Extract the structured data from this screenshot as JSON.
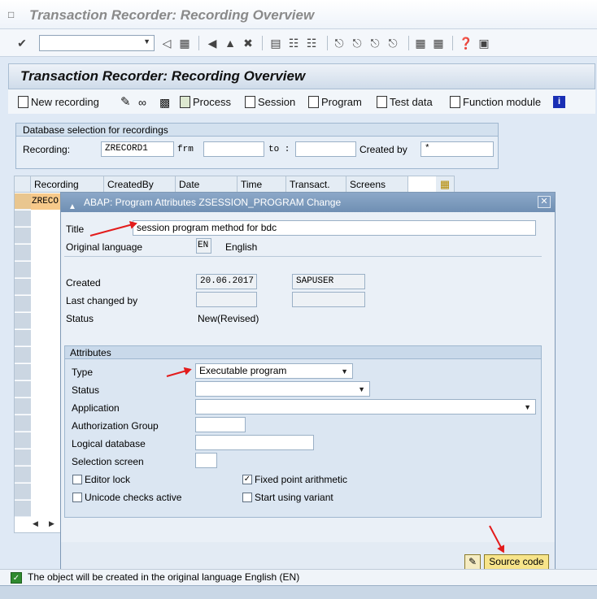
{
  "window": {
    "title": "Transaction Recorder: Recording Overview"
  },
  "toolbar": {
    "command_field": "",
    "icons": [
      "enter-icon",
      "back-icon",
      "save-icon",
      "back-nav-icon",
      "exit-icon",
      "cancel-icon",
      "print-icon",
      "find-icon",
      "find-next-icon",
      "first-page-icon",
      "prev-page-icon",
      "next-page-icon",
      "last-page-icon",
      "new-session-icon",
      "shortcut-icon",
      "help-icon",
      "customize-icon"
    ]
  },
  "screen": {
    "title": "Transaction Recorder: Recording Overview"
  },
  "app_toolbar": {
    "new_recording": "New recording",
    "process": "Process",
    "session": "Session",
    "program": "Program",
    "test_data": "Test data",
    "function_module": "Function module"
  },
  "selection": {
    "caption": "Database selection for recordings",
    "recording_label": "Recording:",
    "recording_value": "ZRECORD1",
    "frm_label": "frm",
    "to_label": "to :",
    "created_by_label": "Created by",
    "created_by_value": "*"
  },
  "table": {
    "columns": [
      "Recording",
      "CreatedBy",
      "Date",
      "Time",
      "Transact.",
      "Screens"
    ],
    "rows": [
      [
        "ZRECO"
      ]
    ]
  },
  "dialog": {
    "title": "ABAP: Program Attributes ZSESSION_PROGRAM Change",
    "title_label": "Title",
    "title_value": "session program method for bdc",
    "orig_lang_label": "Original language",
    "orig_lang_code": "EN",
    "orig_lang_name": "English",
    "created_label": "Created",
    "created_date": "20.06.2017",
    "created_user": "SAPUSER",
    "last_changed_label": "Last changed by",
    "status_label": "Status",
    "status_value": "New(Revised)",
    "attributes": {
      "caption": "Attributes",
      "type_label": "Type",
      "type_value": "Executable program",
      "status_label": "Status",
      "application_label": "Application",
      "auth_group_label": "Authorization Group",
      "logical_db_label": "Logical database",
      "selection_screen_label": "Selection screen",
      "editor_lock_label": "Editor lock",
      "editor_lock_checked": false,
      "fixed_point_label": "Fixed point arithmetic",
      "fixed_point_checked": true,
      "unicode_label": "Unicode checks active",
      "unicode_checked": false,
      "start_variant_label": "Start using variant",
      "start_variant_checked": false
    },
    "source_code_button": "Source code"
  },
  "status_bar": {
    "message": "The object will be created in the original language English (EN)"
  },
  "colors": {
    "annotation_arrow": "#e31b1b",
    "selected_cell": "#f7c98a",
    "source_button": "#f7e48a"
  }
}
